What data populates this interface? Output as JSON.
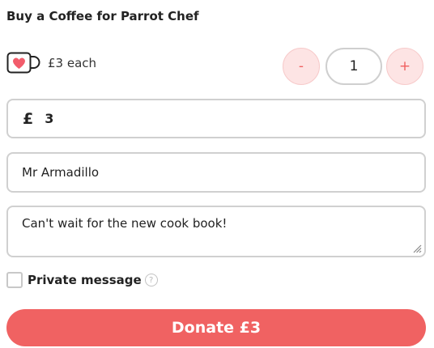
{
  "widget": {
    "title": "Buy a Coffee for Parrot Chef",
    "price_each": "£3 each",
    "cup_icon": "coffee-cup-heart-icon",
    "accent_color": "#f06262",
    "stepper": {
      "minus_label": "-",
      "plus_label": "+",
      "quantity": "1"
    },
    "amount": {
      "currency_symbol": "£",
      "value": "3"
    },
    "name_field": {
      "value": "Mr Armadillo"
    },
    "message_field": {
      "value": "Can't wait for the new cook book!"
    },
    "private": {
      "label": "Private message",
      "help_glyph": "?",
      "checked": false
    },
    "donate_button": {
      "label": "Donate £3"
    }
  }
}
